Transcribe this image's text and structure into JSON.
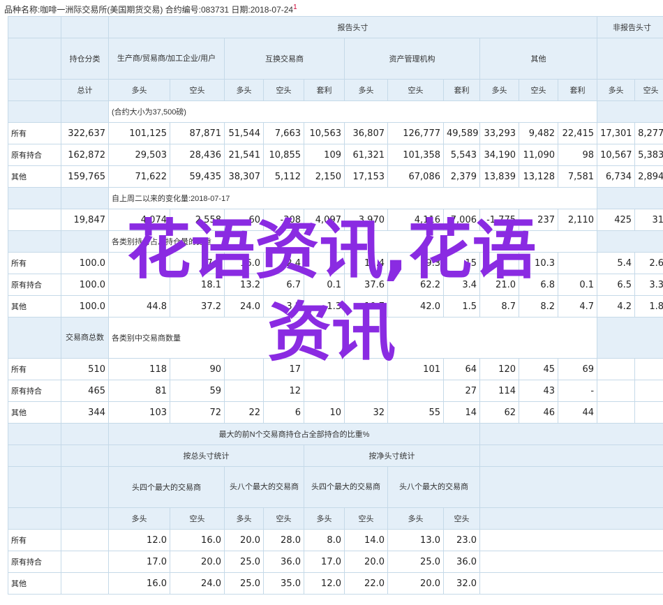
{
  "header": {
    "line": "品种名称:咖啡一洲际交易所(美国期货交易) 合约编号:083731 日期:2018-07-24",
    "mark": "1"
  },
  "table": {
    "group_reportable": "报告头寸",
    "group_nonreportable": "非报告头寸",
    "col_position_class": "持仓分类",
    "cat_producer": "生产商/贸易商/加工企业/用户",
    "cat_swap": "互换交易商",
    "cat_money": "资产管理机构",
    "cat_other": "其他",
    "sub_total": "总计",
    "sub_long": "多头",
    "sub_short": "空头",
    "sub_spread": "套利",
    "sec1_note": "(合约大小为37,500磅)",
    "row_all": "所有",
    "row_old": "原有持合",
    "row_other": "其他",
    "positions": {
      "all": [
        "322,637",
        "101,125",
        "87,871",
        "51,544",
        "7,663",
        "10,563",
        "36,807",
        "126,777",
        "49,589",
        "33,293",
        "9,482",
        "22,415",
        "17,301",
        "8,277"
      ],
      "old": [
        "162,872",
        "29,503",
        "28,436",
        "21,541",
        "10,855",
        "109",
        "61,321",
        "101,358",
        "5,543",
        "34,190",
        "11,090",
        "98",
        "10,567",
        "5,383"
      ],
      "other": [
        "159,765",
        "71,622",
        "59,435",
        "38,307",
        "5,112",
        "2,150",
        "17,153",
        "67,086",
        "2,379",
        "13,839",
        "13,128",
        "7,581",
        "6,734",
        "2,894"
      ]
    },
    "sec2_note": "自上周二以来的变化量:2018-07-17",
    "changes": [
      "19,847",
      "4,074",
      "2,558",
      "-60",
      "-308",
      "4,097",
      "3,970",
      "4,116",
      "7,006",
      "-1,775",
      "237",
      "2,110",
      "425",
      "31"
    ],
    "sec3_note": "各类别持仓占总持仓量的比重",
    "pct": {
      "all": [
        "100.0",
        "",
        "27.2",
        "16.0",
        "2.4",
        "",
        "11.4",
        "39.3",
        "15",
        "",
        "10.3",
        "",
        "5.4",
        "2.6"
      ],
      "old": [
        "100.0",
        "",
        "18.1",
        "13.2",
        "6.7",
        "0.1",
        "37.6",
        "62.2",
        "3.4",
        "21.0",
        "6.8",
        "0.1",
        "6.5",
        "3.3"
      ],
      "other": [
        "100.0",
        "44.8",
        "37.2",
        "24.0",
        "3.2",
        "1.3",
        "10.7",
        "42.0",
        "1.5",
        "8.7",
        "8.2",
        "4.7",
        "4.2",
        "1.8"
      ]
    },
    "sec4_label": "交易商总数",
    "sec4_note": "各类别中交易商数量",
    "traders": {
      "all": [
        "510",
        "118",
        "90",
        "",
        "17",
        "",
        "",
        "101",
        "64",
        "120",
        "45",
        "69"
      ],
      "old": [
        "465",
        "81",
        "59",
        "",
        "12",
        "",
        "",
        "",
        "27",
        "114",
        "43",
        "-"
      ],
      "other": [
        "344",
        "103",
        "72",
        "22",
        "6",
        "10",
        "32",
        "55",
        "14",
        "62",
        "46",
        "44"
      ]
    },
    "conc_title": "最大的前N个交易商持仓占全部持合的比重%",
    "conc_gross": "按总头寸统计",
    "conc_net": "按净头寸统计",
    "conc_top4": "头四个最大的交易商",
    "conc_top8": "头八个最大的交易商",
    "concentration": {
      "all": [
        "12.0",
        "16.0",
        "20.0",
        "28.0",
        "8.0",
        "14.0",
        "13.0",
        "23.0"
      ],
      "old": [
        "17.0",
        "20.0",
        "25.0",
        "36.0",
        "17.0",
        "20.0",
        "25.0",
        "36.0"
      ],
      "other": [
        "16.0",
        "24.0",
        "25.0",
        "35.0",
        "12.0",
        "22.0",
        "20.0",
        "32.0"
      ]
    }
  },
  "watermark": {
    "line1": "花语资讯,花语",
    "line2": "资讯"
  }
}
